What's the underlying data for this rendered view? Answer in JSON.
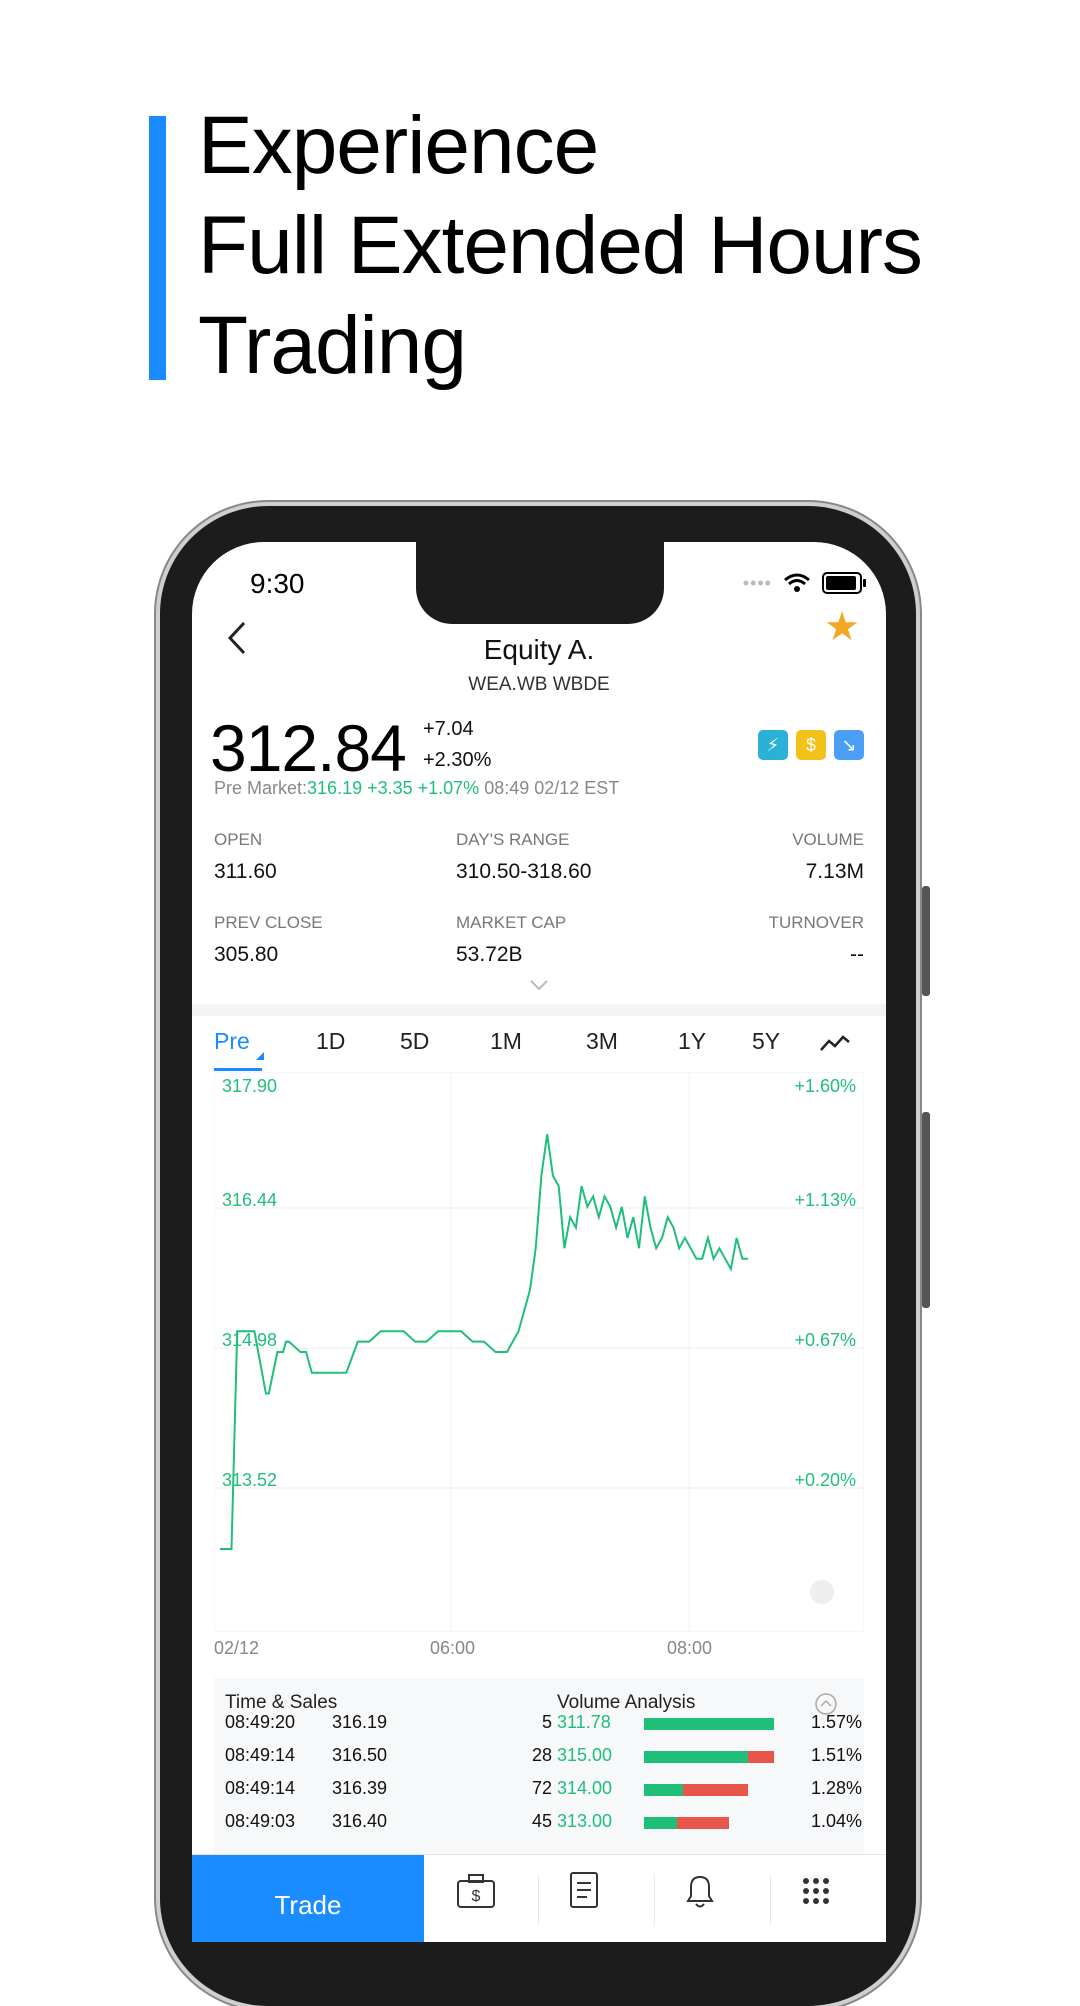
{
  "headline": [
    "Experience",
    "Full Extended Hours",
    "Trading"
  ],
  "status": {
    "time": "9:30"
  },
  "header": {
    "title": "Equity A.",
    "subtitle": "WEA.WB WBDE"
  },
  "quote": {
    "price": "312.84",
    "change": "+7.04",
    "change_pct": "+2.30%",
    "pre_label": "Pre Market:",
    "pre_values": "316.19 +3.35 +1.07%",
    "pre_time": "08:49 02/12 EST"
  },
  "stats": [
    {
      "label": "OPEN",
      "value": "311.60"
    },
    {
      "label": "DAY'S RANGE",
      "value": "310.50-318.60"
    },
    {
      "label": "VOLUME",
      "value": "7.13M"
    },
    {
      "label": "PREV CLOSE",
      "value": "305.80"
    },
    {
      "label": "MARKET CAP",
      "value": "53.72B"
    },
    {
      "label": "TURNOVER",
      "value": "--"
    }
  ],
  "tabs": [
    "Pre",
    "1D",
    "5D",
    "1M",
    "3M",
    "1Y",
    "5Y"
  ],
  "chart_data": {
    "type": "line",
    "y_left_ticks": [
      "317.90",
      "316.44",
      "314.98",
      "313.52"
    ],
    "y_right_ticks": [
      "+1.60%",
      "+1.13%",
      "+0.67%",
      "+0.20%"
    ],
    "x_ticks": [
      "02/12",
      "06:00",
      "08:00"
    ],
    "ylim": [
      312.6,
      318.0
    ],
    "x": [
      0,
      2,
      3,
      6,
      8,
      8.5,
      10,
      11,
      11.5,
      12,
      14,
      15,
      16,
      18,
      20,
      22,
      24,
      26,
      28,
      30,
      32,
      34,
      36,
      38,
      40,
      42,
      44,
      46,
      48,
      50,
      52,
      54,
      55,
      56,
      57,
      58,
      59,
      60,
      61,
      62,
      63,
      64,
      65,
      66,
      67,
      68,
      69,
      70,
      71,
      72,
      73,
      74,
      75,
      76,
      77,
      78,
      79,
      80,
      81,
      82,
      83,
      84,
      85,
      86,
      87,
      88,
      89,
      90,
      91,
      92
    ],
    "y": [
      313.4,
      313.4,
      315.5,
      315.5,
      314.9,
      314.9,
      315.3,
      315.3,
      315.4,
      315.4,
      315.3,
      315.3,
      315.1,
      315.1,
      315.1,
      315.1,
      315.4,
      315.4,
      315.5,
      315.5,
      315.5,
      315.4,
      315.4,
      315.5,
      315.5,
      315.5,
      315.4,
      315.4,
      315.3,
      315.3,
      315.5,
      315.9,
      316.3,
      317.0,
      317.4,
      317.0,
      316.9,
      316.3,
      316.6,
      316.5,
      316.9,
      316.7,
      316.8,
      316.6,
      316.8,
      316.7,
      316.5,
      316.7,
      316.4,
      316.6,
      316.3,
      316.8,
      316.5,
      316.3,
      316.4,
      316.6,
      316.5,
      316.3,
      316.4,
      316.3,
      316.2,
      316.2,
      316.4,
      316.2,
      316.3,
      316.2,
      316.1,
      316.4,
      316.2,
      316.2
    ]
  },
  "time_sales": {
    "title": "Time & Sales",
    "rows": [
      {
        "time": "08:49:20",
        "price": "316.19",
        "size": "5"
      },
      {
        "time": "08:49:14",
        "price": "316.50",
        "size": "28"
      },
      {
        "time": "08:49:14",
        "price": "316.39",
        "size": "72"
      },
      {
        "time": "08:49:03",
        "price": "316.40",
        "size": "45"
      }
    ]
  },
  "volume_analysis": {
    "title": "Volume Analysis",
    "rows": [
      {
        "price": "311.78",
        "pct": "1.57%",
        "buy": 1.0,
        "sell": 0.0
      },
      {
        "price": "315.00",
        "pct": "1.51%",
        "buy": 0.8,
        "sell": 0.2
      },
      {
        "price": "314.00",
        "pct": "1.28%",
        "buy": 0.3,
        "sell": 0.5
      },
      {
        "price": "313.00",
        "pct": "1.04%",
        "buy": 0.25,
        "sell": 0.4
      }
    ]
  },
  "nav": {
    "trade_label": "Trade"
  },
  "colors": {
    "accent": "#1a8cff",
    "up": "#1fbf7a",
    "down": "#e8554a",
    "star": "#f5a623"
  }
}
